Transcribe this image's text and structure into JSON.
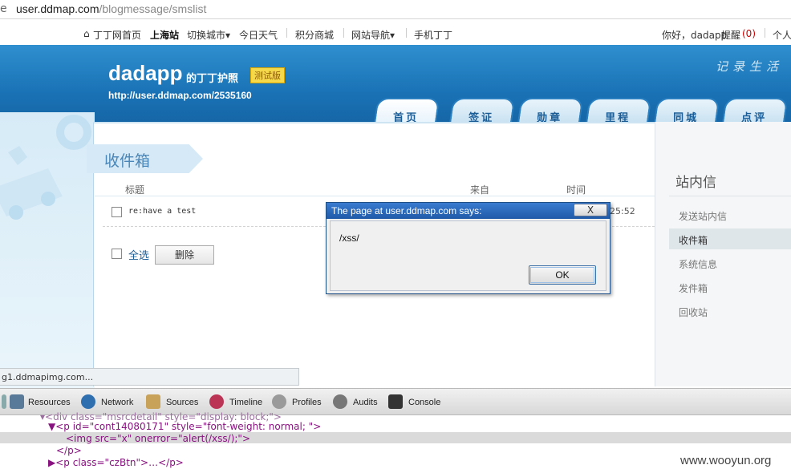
{
  "address_bar": {
    "prefix_glyph": "e",
    "host": "user.ddmap.com",
    "path": "/blogmessage/smslist"
  },
  "top_nav": {
    "home": "丁丁网首页",
    "city": "上海站",
    "switch_city": "切换城市▾",
    "weather": "今日天气",
    "points_mall": "积分商城",
    "site_nav": "网站导航▾",
    "mobile": "手机丁丁",
    "greeting": "你好，dadapp",
    "reminder": "提醒",
    "reminder_count": "(0)",
    "personal": "个人"
  },
  "header": {
    "brand": "dadapp",
    "brand_suffix": "的丁丁护照",
    "beta_badge": "测试版",
    "home_url": "http://user.ddmap.com/2535160",
    "slogan": "记录生活"
  },
  "tabs": [
    "首页",
    "签证",
    "勋章",
    "里程",
    "同城",
    "点评"
  ],
  "inbox": {
    "title": "收件箱",
    "col_subject": "标题",
    "col_from": "来自",
    "col_time": "时间",
    "message_subject": "re:have a test",
    "message_time": "25:52",
    "select_all": "全选",
    "delete_button": "删除"
  },
  "right_panel": {
    "title": "站内信",
    "items": [
      "发送站内信",
      "收件箱",
      "系统信息",
      "发件箱",
      "回收站"
    ],
    "active": "收件箱"
  },
  "dialog": {
    "title": "The page at user.ddmap.com says:",
    "close": "X",
    "message": "/xss/",
    "ok": "OK"
  },
  "status_bar": "g1.ddmapimg.com...",
  "devtools": {
    "tabs": [
      "Resources",
      "Network",
      "Sources",
      "Timeline",
      "Profiles",
      "Audits",
      "Console"
    ],
    "code_lines": [
      "▾<div class=\"msrcdetail\" style=\"display: block;\">",
      "▼<p id=\"cont14080171\" style=\"font-weight: normal; \">",
      "<img src=\"x\" onerror=\"alert(/xss/);\">",
      "</p>",
      "▶<p class=\"czBtn\">…</p>"
    ]
  },
  "watermark": "www.wooyun.org",
  "colors": {
    "banner": "#1a73b6",
    "tab_text": "#1b5d97",
    "dialog_title": "#1f5aa8"
  }
}
